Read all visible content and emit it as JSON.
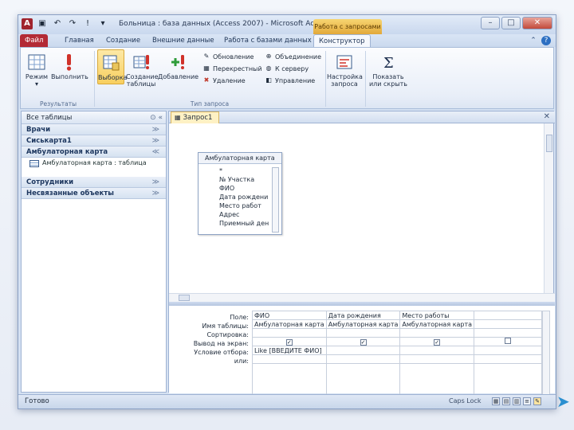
{
  "window": {
    "title": "Больница : база данных (Access 2007) - Microsoft Access",
    "context_tab": "Работа с запросами",
    "qat_icons": [
      "access-app-icon",
      "save-icon",
      "undo-icon",
      "redo-icon",
      "run-icon",
      "customize-icon"
    ]
  },
  "tabs": {
    "file": "Файл",
    "home": "Главная",
    "create": "Создание",
    "external": "Внешние данные",
    "dbtools": "Работа с базами данных",
    "design": "Конструктор"
  },
  "ribbon": {
    "results": {
      "view": "Режим",
      "run": "Выполнить",
      "label": "Результаты"
    },
    "query_type": {
      "select": "Выборка",
      "make_table": "Создание таблицы",
      "append": "Добавление",
      "update": "Обновление",
      "crosstab": "Перекрестный",
      "delete": "Удаление",
      "union": "Объединение",
      "pass_through": "К серверу",
      "data_def": "Управление",
      "label": "Тип запроса"
    },
    "setup": {
      "label": "Настройка запроса"
    },
    "show_hide": {
      "label": "Показать или скрыть"
    }
  },
  "nav": {
    "header": "Все таблицы",
    "groups": [
      {
        "label": "Врачи"
      },
      {
        "label": "Сиськарта1"
      },
      {
        "label": "Амбулаторная карта",
        "expanded": true,
        "items": [
          "Амбулаторная карта : таблица"
        ]
      },
      {
        "label": "Сотрудники"
      },
      {
        "label": "Несвязанные объекты"
      }
    ]
  },
  "document": {
    "tab_label": "Запрос1",
    "table": {
      "name": "Амбулаторная карта",
      "fields": [
        "*",
        "№ Участка",
        "ФИО",
        "Дата рождени",
        "Место работ",
        "Адрес",
        "Приемный ден"
      ]
    },
    "grid": {
      "row_labels": [
        "Поле:",
        "Имя таблицы:",
        "Сортировка:",
        "Вывод на экран:",
        "Условие отбора:",
        "или:"
      ],
      "columns": [
        {
          "field": "ФИО",
          "table": "Амбулаторная карта",
          "show": true,
          "criteria": "Like [ВВЕДИТЕ ФИО]"
        },
        {
          "field": "Дата рождения",
          "table": "Амбулаторная карта",
          "show": true,
          "criteria": ""
        },
        {
          "field": "Место работы",
          "table": "Амбулаторная карта",
          "show": true,
          "criteria": ""
        },
        {
          "field": "",
          "table": "",
          "show": false,
          "criteria": ""
        }
      ]
    }
  },
  "status": {
    "text": "Готово",
    "caps": "Caps Lock"
  }
}
